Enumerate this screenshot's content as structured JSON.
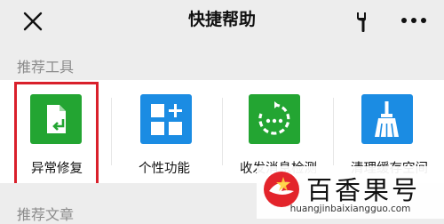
{
  "header": {
    "title": "快捷帮助"
  },
  "sections": {
    "tools_label": "推荐工具",
    "articles_label": "推荐文章"
  },
  "tools": [
    {
      "label": "异常修复",
      "icon": "file-repair-icon",
      "color": "#23a532"
    },
    {
      "label": "个性功能",
      "icon": "grid-plus-icon",
      "color": "#1b8ce3"
    },
    {
      "label": "收发消息检测",
      "icon": "circular-arrow-icon",
      "color": "#23a532"
    },
    {
      "label": "清理缓存空间",
      "icon": "broom-icon",
      "color": "#1b8ce3"
    }
  ],
  "watermark": {
    "name": "百香果号",
    "url": "huangjinbaixiangguo.com"
  },
  "colors": {
    "highlight": "#d9202b",
    "green": "#23a532",
    "blue": "#1b8ce3",
    "background": "#ededed"
  }
}
